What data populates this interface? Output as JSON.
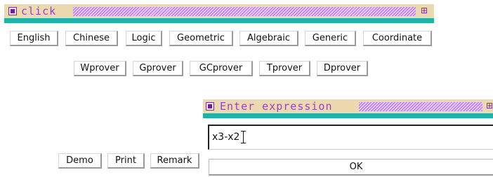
{
  "main_window": {
    "title": "click"
  },
  "language_buttons": [
    "English",
    "Chinese",
    "Logic",
    "Geometric",
    "Algebraic",
    "Generic",
    "Coordinate"
  ],
  "prover_buttons": [
    "Wprover",
    "Gprover",
    "GCprover",
    "Tprover",
    "Dprover"
  ],
  "bottom_buttons": [
    "Demo",
    "Print",
    "Remark"
  ],
  "dialog": {
    "title": "Enter expression",
    "input_value": "x3-x2",
    "ok_label": "OK"
  },
  "icons": {
    "close_box": "close-box-icon",
    "maximize": "maximize-icon",
    "text_cursor": "i-beam-cursor-icon"
  },
  "colors": {
    "titlebar_bg": "#ecd9b0",
    "title_text": "#9b3fc9",
    "accent_bar": "#1bb3a6",
    "stripes": "#b46fe0"
  }
}
